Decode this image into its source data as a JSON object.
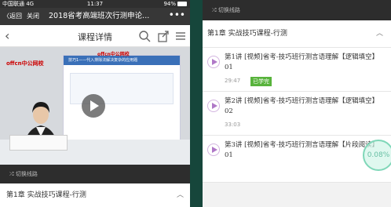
{
  "status": {
    "carrier": "中国联通 4G",
    "time": "11:37",
    "battery": "94%"
  },
  "wechat": {
    "back": "〈返回",
    "close": "关闭",
    "title": "2018省考高端班次行测申论...",
    "more": "•••"
  },
  "app": {
    "page_title": "课程详情"
  },
  "video": {
    "logo": "offcn中公网校",
    "logo_small": "offcn中公网校",
    "slide_title": "技巧1——代入排除法解决复杂的应用题"
  },
  "course": {
    "switch_label": "切换线路",
    "chapter": "第1章   实战技巧课程-行测"
  },
  "lessons": [
    {
      "title": "第1讲  [视频]省考-技巧班行测言语理解【逻辑填空】01",
      "duration": "29:47",
      "badge": "已学完"
    },
    {
      "title": "第2讲  [视频]省考-技巧班行测言语理解【逻辑填空】02",
      "duration": "33:03"
    },
    {
      "title": "第3讲  [视频]省考-技巧班行测言语理解【片段阅读】01"
    }
  ],
  "progress": {
    "label": "0.08%"
  },
  "colors": {
    "accent": "#b078c8",
    "badge": "#58b33c",
    "border": "#1e4f44"
  }
}
